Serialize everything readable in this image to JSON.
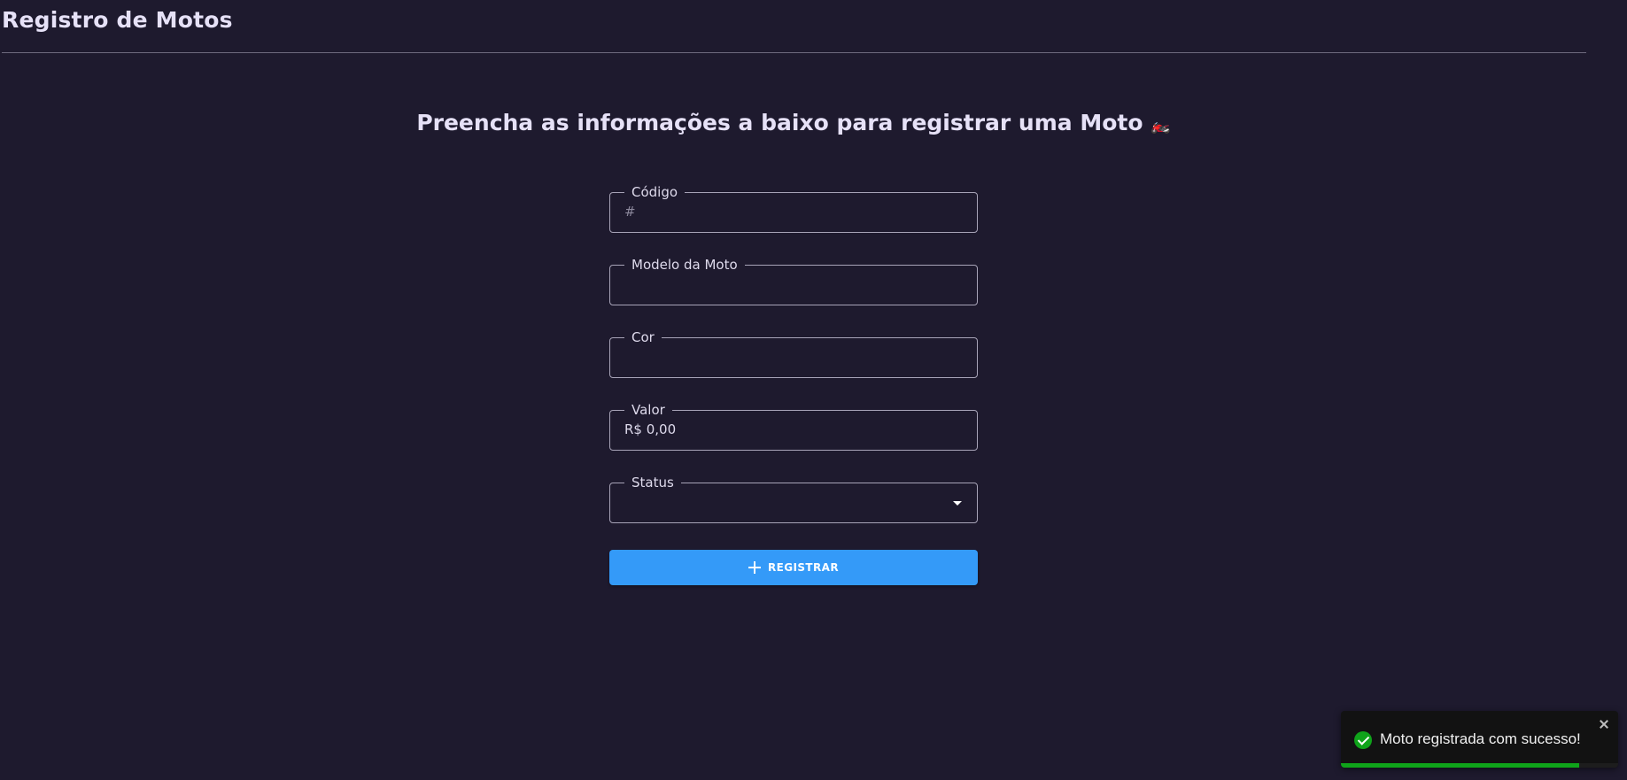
{
  "header": {
    "title": "Registro de Motos"
  },
  "form": {
    "heading": "Preencha as informações a baixo para registrar uma Moto",
    "heading_emoji": "🏍️",
    "fields": {
      "codigo": {
        "label": "Código",
        "placeholder": "#",
        "value": ""
      },
      "modelo": {
        "label": "Modelo da Moto",
        "value": ""
      },
      "cor": {
        "label": "Cor",
        "value": ""
      },
      "valor": {
        "label": "Valor",
        "value": "R$ 0,00"
      },
      "status": {
        "label": "Status",
        "value": ""
      }
    },
    "submit_label": "REGISTRAR",
    "submit_icon": "plus-icon",
    "submit_color": "#349af8"
  },
  "toast": {
    "message": "Moto registrada com sucesso!",
    "icon": "check-circle-icon",
    "status_color": "#0fa31a",
    "progress": 0.86
  },
  "theme": {
    "background": "#1e1a2e",
    "text": "#e6e1f7"
  }
}
